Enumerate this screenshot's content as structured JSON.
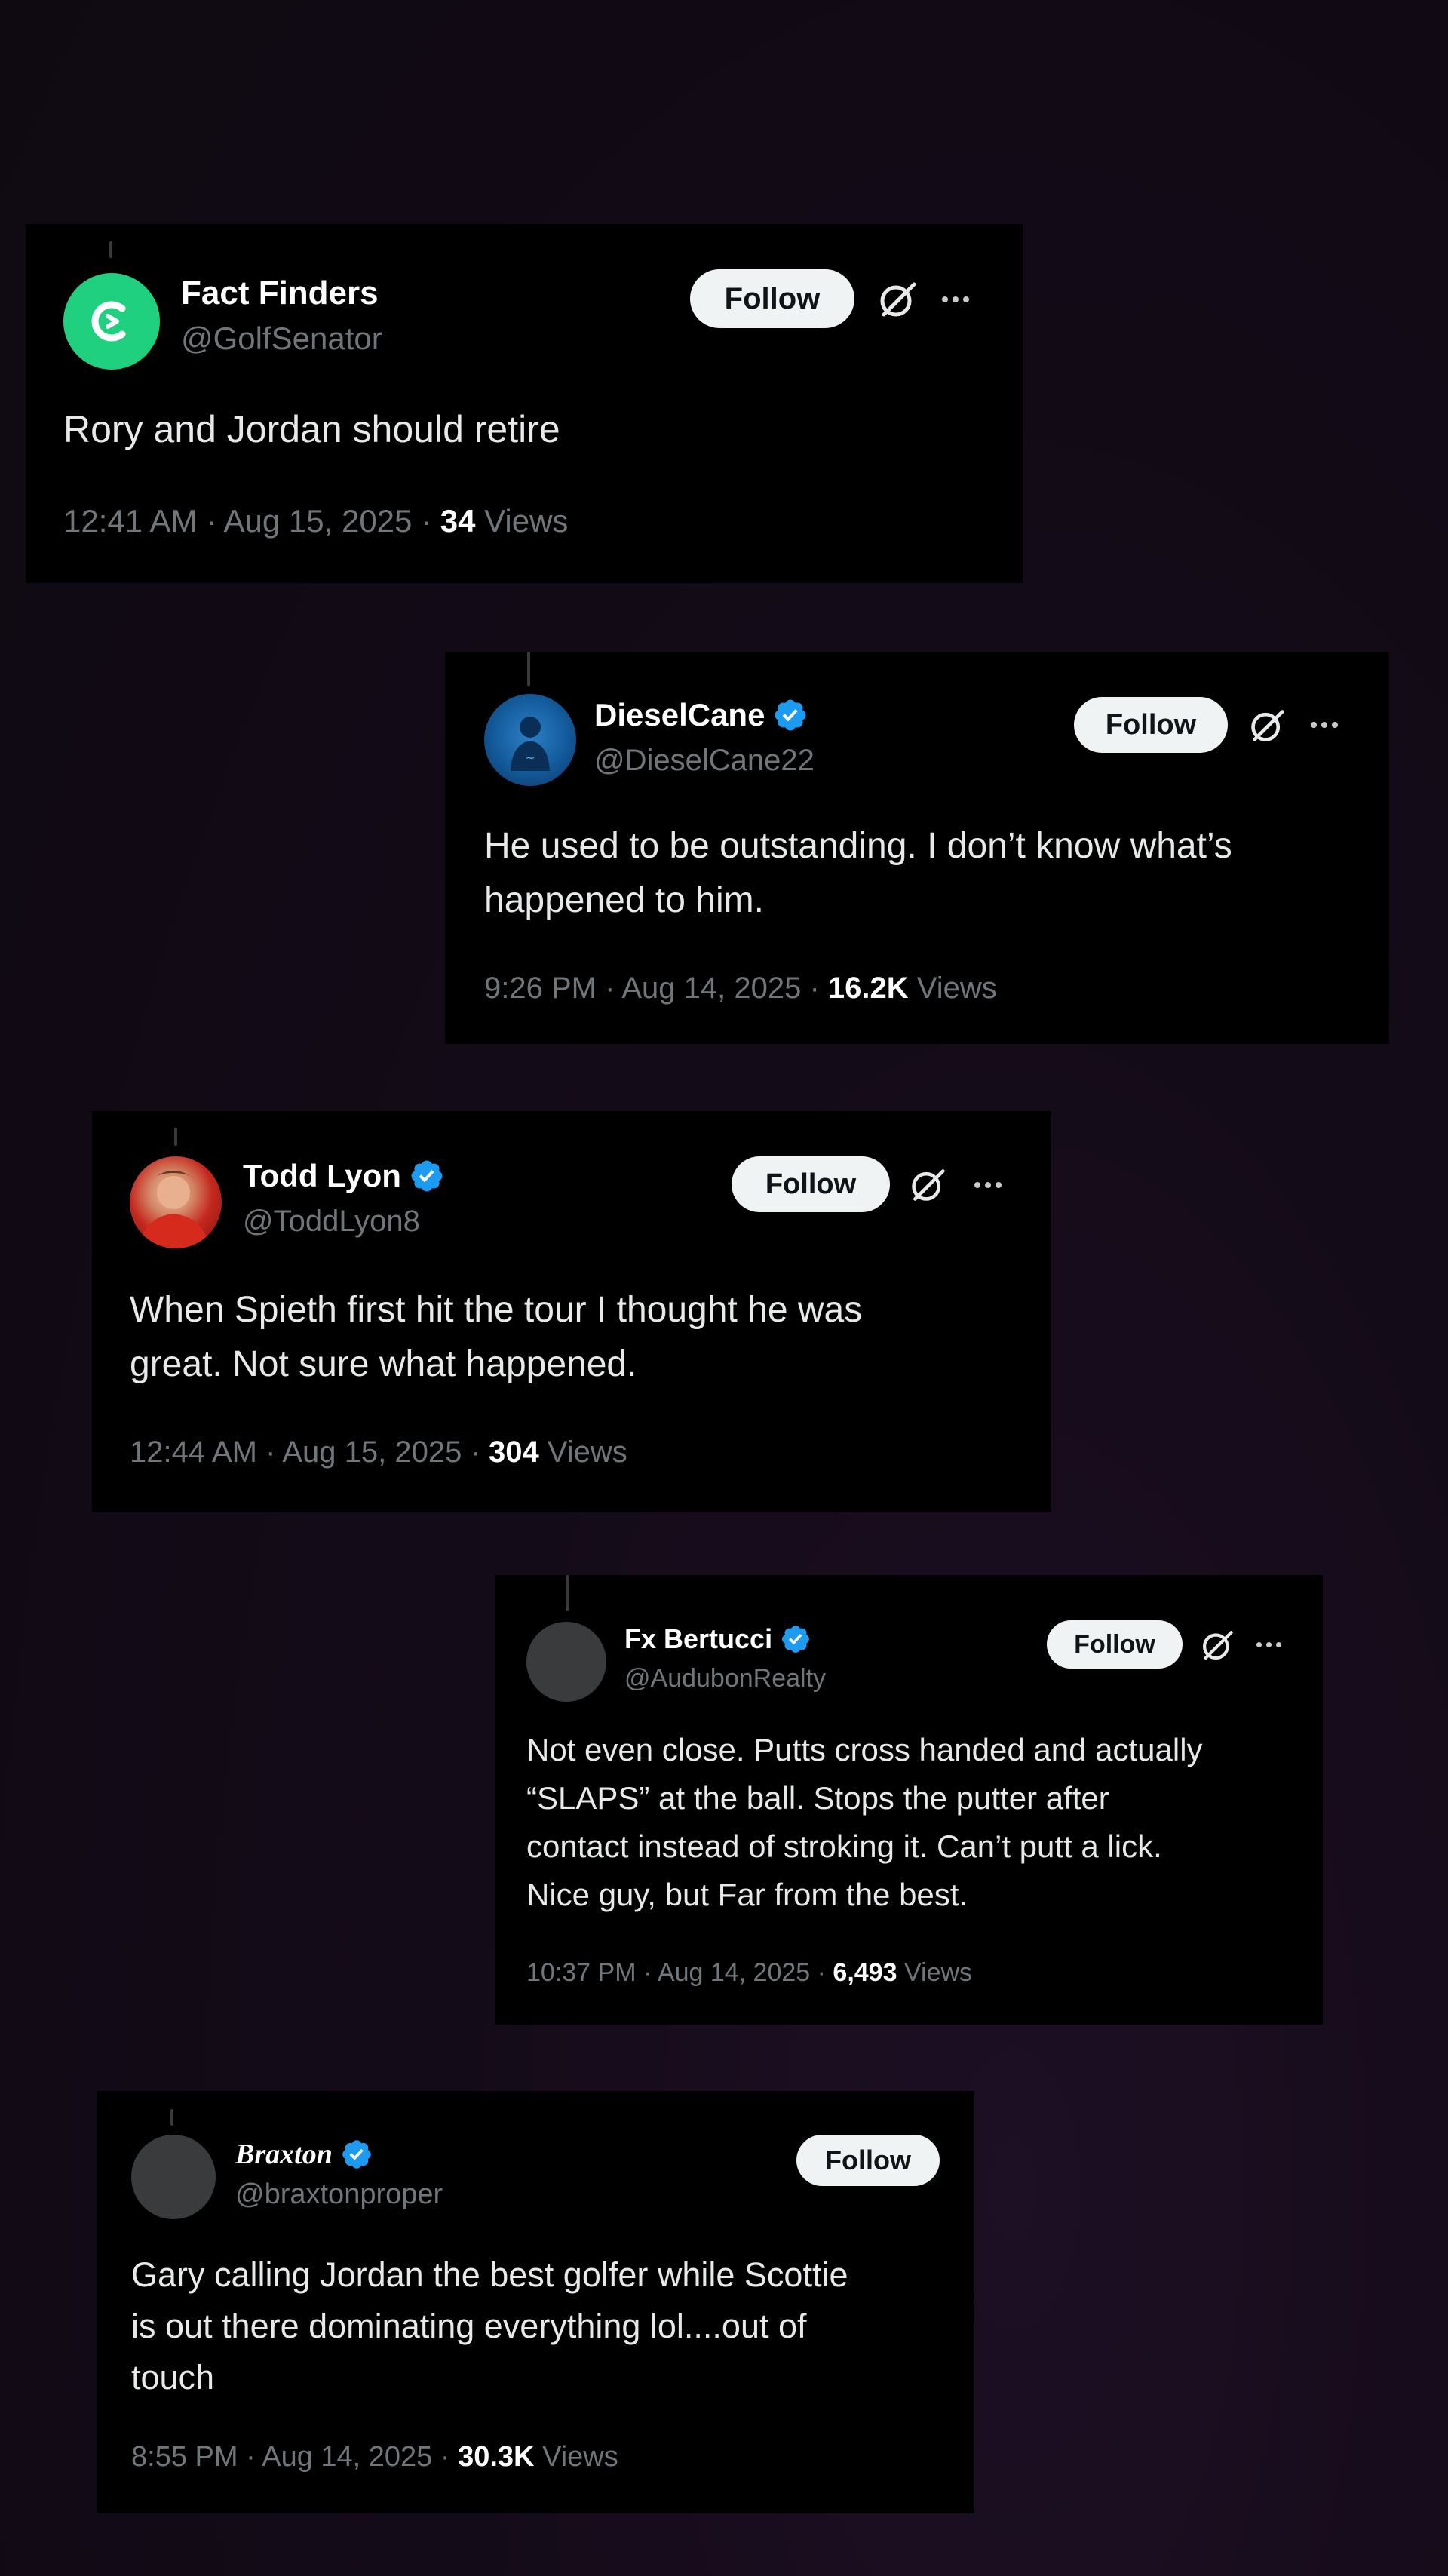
{
  "tweets": [
    {
      "display_name": "Fact Finders",
      "handle": "@GolfSenator",
      "verified": false,
      "avatar": "fact-finders-logo",
      "follow_label": "Follow",
      "text": "Rory and Jordan should retire",
      "time": "12:41 AM",
      "date": "Aug 15, 2025",
      "separator": "·",
      "views_count": "34",
      "views_label": "Views"
    },
    {
      "display_name": "DieselCane",
      "handle": "@DieselCane22",
      "verified": true,
      "avatar": "blue-avatar",
      "follow_label": "Follow",
      "text": "He used to be outstanding. I don’t know what’s\nhappened to him.",
      "time": "9:26 PM",
      "date": "Aug 14, 2025",
      "separator": "·",
      "views_count": "16.2K",
      "views_label": "Views"
    },
    {
      "display_name": "Todd Lyon",
      "handle": "@ToddLyon8",
      "verified": true,
      "avatar": "photo-avatar",
      "follow_label": "Follow",
      "text": "When Spieth first hit the tour I thought he was\ngreat. Not sure what happened.",
      "time": "12:44 AM",
      "date": "Aug 15, 2025",
      "separator": "·",
      "views_count": "304",
      "views_label": "Views"
    },
    {
      "display_name": "Fx Bertucci",
      "handle": "@AudubonRealty",
      "verified": true,
      "avatar": "blank-avatar",
      "follow_label": "Follow",
      "text": "Not even close. Putts cross handed and actually\n“SLAPS” at the ball. Stops the putter after\ncontact instead of stroking it. Can’t putt a lick.\nNice guy, but Far from the best.",
      "time": "10:37 PM",
      "date": "Aug 14, 2025",
      "separator": "·",
      "views_count": "6,493",
      "views_label": "Views"
    },
    {
      "display_name": "Braxton",
      "handle": "@braxtonproper",
      "verified": true,
      "avatar": "blank-avatar",
      "follow_label": "Follow",
      "text": "Gary calling Jordan the best golfer while Scottie\nis out there dominating everything lol....out of\ntouch",
      "time": "8:55 PM",
      "date": "Aug 14, 2025",
      "separator": "·",
      "views_count": "30.3K",
      "views_label": "Views"
    }
  ],
  "colors": {
    "background": "#120b15",
    "card": "#000000",
    "text": "#e7e9ea",
    "muted": "#71767b",
    "verified": "#1d9bf0",
    "follow_bg": "#eff3f4",
    "fact_finders_green": "#1fd07f"
  }
}
